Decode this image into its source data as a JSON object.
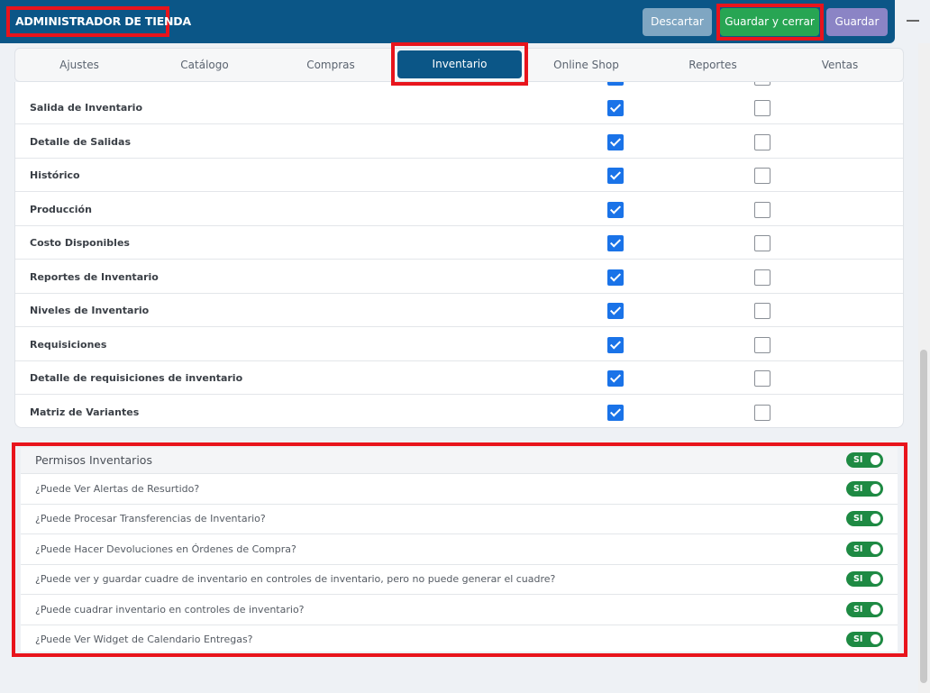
{
  "header": {
    "title": "ADMINISTRADOR DE TIENDA",
    "discard_label": "Descartar",
    "save_close_label": "Guardar y cerrar",
    "save_label": "Guardar"
  },
  "tabs": [
    {
      "label": "Ajustes",
      "active": false
    },
    {
      "label": "Catálogo",
      "active": false
    },
    {
      "label": "Compras",
      "active": false
    },
    {
      "label": "Inventario",
      "active": true
    },
    {
      "label": "Online Shop",
      "active": false
    },
    {
      "label": "Reportes",
      "active": false
    },
    {
      "label": "Ventas",
      "active": false
    }
  ],
  "permissions": {
    "rows": [
      {
        "label": "Salida de Inventario",
        "col1_checked": true,
        "col2_checked": false
      },
      {
        "label": "Detalle de Salidas",
        "col1_checked": true,
        "col2_checked": false
      },
      {
        "label": "Histórico",
        "col1_checked": true,
        "col2_checked": false
      },
      {
        "label": "Producción",
        "col1_checked": true,
        "col2_checked": false
      },
      {
        "label": "Costo Disponibles",
        "col1_checked": true,
        "col2_checked": false
      },
      {
        "label": "Reportes de Inventario",
        "col1_checked": true,
        "col2_checked": false
      },
      {
        "label": "Niveles de Inventario",
        "col1_checked": true,
        "col2_checked": false
      },
      {
        "label": "Requisiciones",
        "col1_checked": true,
        "col2_checked": false
      },
      {
        "label": "Detalle de requisiciones de inventario",
        "col1_checked": true,
        "col2_checked": false
      },
      {
        "label": "Matriz de Variantes",
        "col1_checked": true,
        "col2_checked": false
      }
    ]
  },
  "inventory_permissions": {
    "title": "Permisos Inventarios",
    "title_toggle": "SI",
    "items": [
      {
        "label": "¿Puede Ver Alertas de Resurtido?",
        "toggle": "SI"
      },
      {
        "label": "¿Puede Procesar Transferencias de Inventario?",
        "toggle": "SI"
      },
      {
        "label": "¿Puede Hacer Devoluciones en Órdenes de Compra?",
        "toggle": "SI"
      },
      {
        "label": "¿Puede ver y guardar cuadre de inventario en controles de inventario, pero no puede generar el cuadre?",
        "toggle": "SI"
      },
      {
        "label": "¿Puede cuadrar inventario en controles de inventario?",
        "toggle": "SI"
      },
      {
        "label": "¿Puede Ver Widget de Calendario Entregas?",
        "toggle": "SI"
      }
    ]
  },
  "colors": {
    "header_bg": "#0b5687",
    "active_tab": "#0b5687",
    "checkbox_checked": "#1a73e8",
    "toggle_on": "#1e8a43",
    "save_close": "#27a553",
    "save": "#8b84c5",
    "discard": "#7fa6c2",
    "highlight_frame": "#e8141c"
  }
}
